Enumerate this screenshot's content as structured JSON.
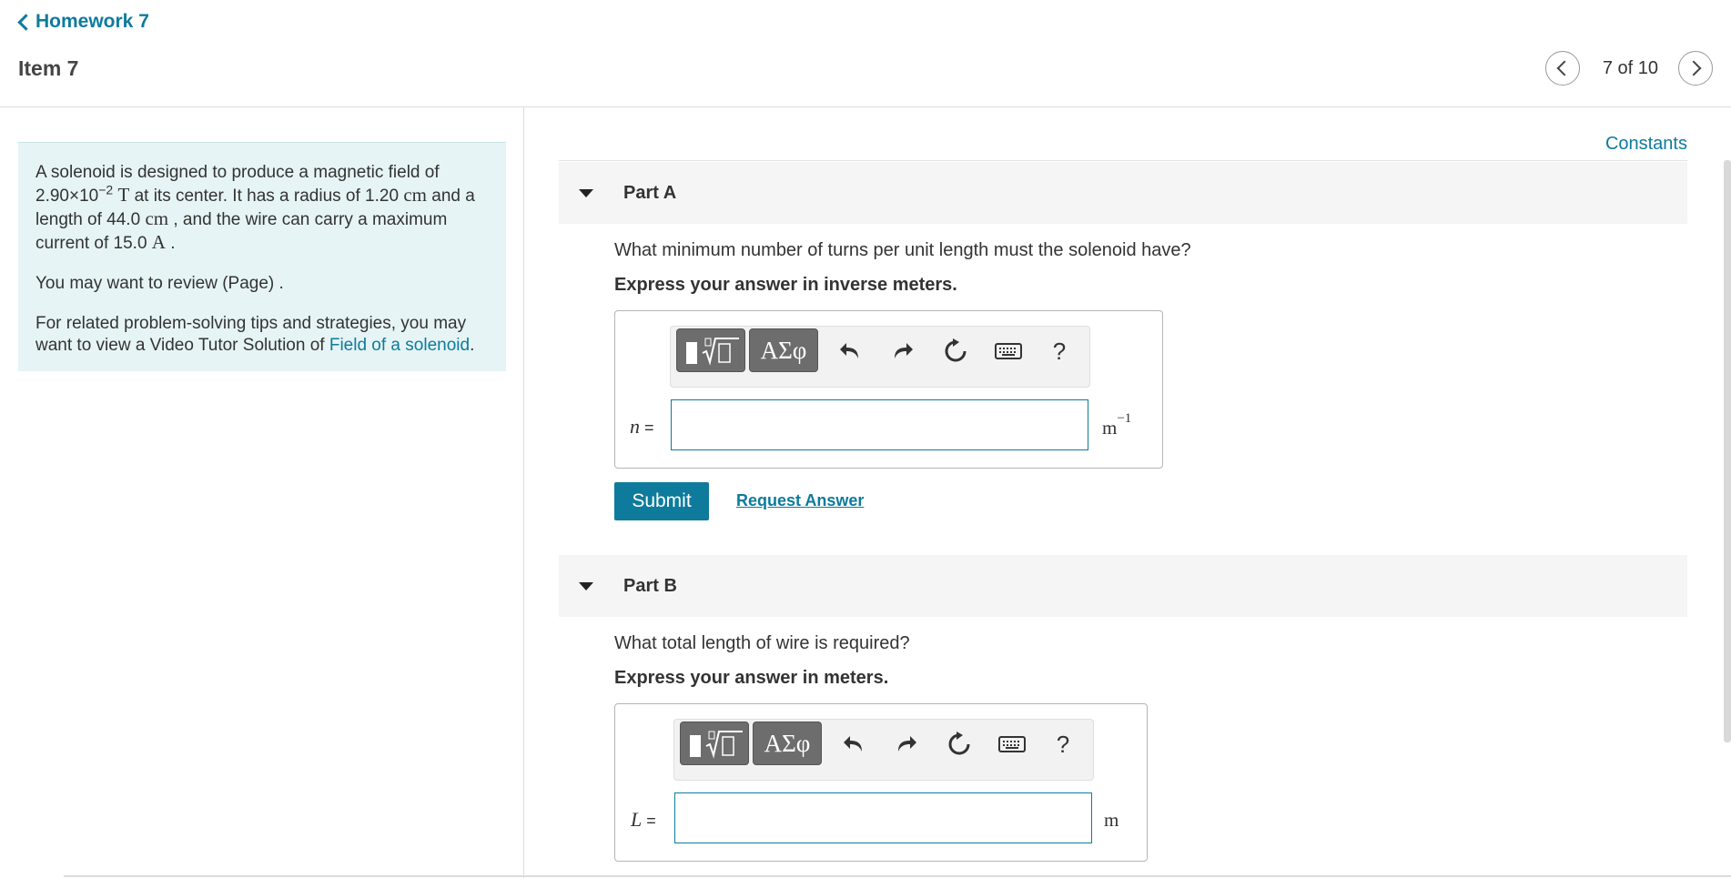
{
  "header": {
    "back_label": "Homework 7",
    "item_title": "Item 7",
    "pager_text": "7 of 10"
  },
  "intro": {
    "p1_text_a": "A solenoid is designed to produce a magnetic field of",
    "p1_field_mantissa": "2.90×10",
    "p1_field_exponent": "−2",
    "p1_field_unit": "T",
    "p1_text_b": " at its center. It has a radius of 1.20 ",
    "p1_radius_unit": "cm",
    "p1_text_c": " and a length of 44.0 ",
    "p1_length_unit": "cm",
    "p1_text_d": " , and the wire can carry a maximum current of 15.0 ",
    "p1_current_unit": "A",
    "p1_text_e": " .",
    "p2": "You may want to review (Page) .",
    "p3_text": "For related problem-solving tips and strategies, you may want to view a Video Tutor Solution of ",
    "p3_link": "Field of a solenoid",
    "p3_end": "."
  },
  "constants_link": "Constants",
  "toolbar": {
    "templates_icon": "templates-icon",
    "greek_label": "ΑΣφ",
    "undo_icon": "undo-icon",
    "redo_icon": "redo-icon",
    "reset_icon": "reset-icon",
    "keyboard_icon": "keyboard-icon",
    "help_label": "?"
  },
  "partA": {
    "label": "Part A",
    "question": "What minimum number of turns per unit length must the solenoid have?",
    "instruction": "Express your answer in inverse meters.",
    "var": "n",
    "eq": " =",
    "input_value": "",
    "unit": "m",
    "unit_exp": "−1",
    "submit_label": "Submit",
    "request_label": "Request Answer"
  },
  "partB": {
    "label": "Part B",
    "question": "What total length of wire is required?",
    "instruction": "Express your answer in meters.",
    "var": "L",
    "eq": " =",
    "input_value": "",
    "unit": "m"
  },
  "colors": {
    "accent": "#0e7b9c",
    "intro_bg": "#e6f4f5",
    "toolbar_button": "#6d6d6d"
  }
}
